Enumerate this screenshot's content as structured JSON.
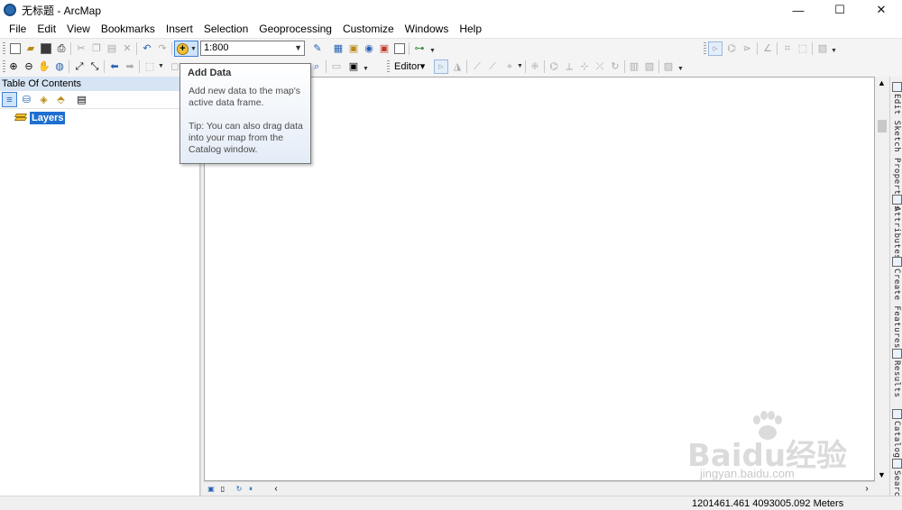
{
  "window": {
    "title": "无标题 - ArcMap",
    "minimize_glyph": "—",
    "maximize_glyph": "☐",
    "close_glyph": "✕"
  },
  "menu": {
    "items": [
      "File",
      "Edit",
      "View",
      "Bookmarks",
      "Insert",
      "Selection",
      "Geoprocessing",
      "Customize",
      "Windows",
      "Help"
    ]
  },
  "toolbar": {
    "scale": "1:800",
    "editor_label": "Editor▾"
  },
  "tooltip": {
    "title": "Add Data",
    "body": "Add new data to the map's active data frame.",
    "tip": "Tip: You can also drag data into your map from the Catalog window."
  },
  "toc": {
    "header": "Table Of Contents",
    "root_layer": "Layers"
  },
  "dock": {
    "tabs": [
      "Edit Sketch Properties",
      "Attributes",
      "Create Features",
      "Results",
      "Catalog",
      "Search"
    ]
  },
  "status": {
    "coordinates": "1201461.461   4093005.092 Meters"
  },
  "watermark": {
    "main": "Baidu经验",
    "sub": "jingyan.baidu.com"
  },
  "colors": {
    "selection_blue": "#1f6fd0",
    "toc_header": "#d6e4f3",
    "active_button": "#cfe3fa"
  }
}
